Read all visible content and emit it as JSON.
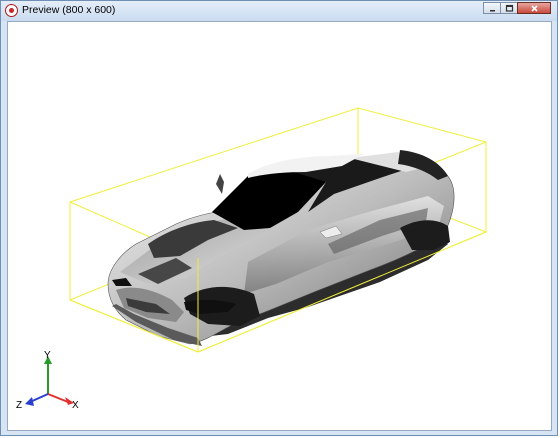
{
  "window": {
    "title": "Preview (800 x 600)",
    "controls": [
      "minimize",
      "maximize",
      "close"
    ]
  },
  "viewport": {
    "background": "#ffffff",
    "bounding_box_color": "#f0ee3c"
  },
  "axes": {
    "x_label": "X",
    "y_label": "Y",
    "z_label": "Z",
    "x_color": "#e03030",
    "y_color": "#2a9a2a",
    "z_color": "#2a3fcf"
  }
}
